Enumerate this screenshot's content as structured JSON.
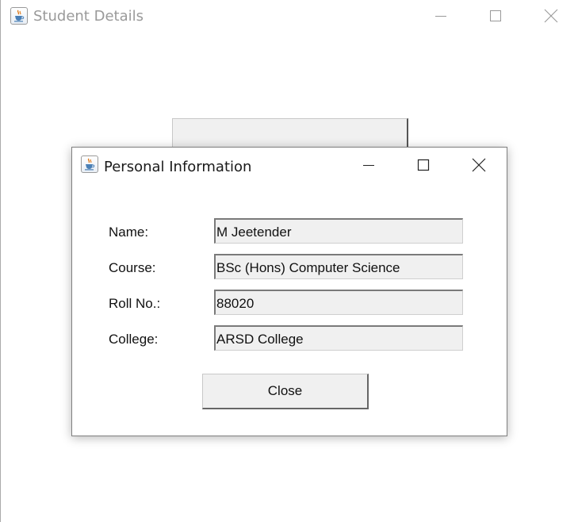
{
  "main_window": {
    "title": "Student Details",
    "icon": "java-cup-icon",
    "controls": [
      "minimize-icon",
      "maximize-icon",
      "close-icon"
    ]
  },
  "dialog": {
    "title": "Personal Information",
    "icon": "java-cup-icon",
    "controls": [
      "minimize-icon",
      "maximize-icon",
      "close-icon"
    ],
    "fields": [
      {
        "label": "Name:",
        "value": "M Jeetender"
      },
      {
        "label": "Course:",
        "value": "BSc (Hons) Computer Science"
      },
      {
        "label": "Roll No.:",
        "value": "88020"
      },
      {
        "label": "College:",
        "value": "ARSD College"
      }
    ],
    "close_button_label": "Close"
  },
  "colors": {
    "inactive_title_text": "#9a9a9a",
    "active_title_text": "#1a1a1a",
    "field_background": "#f0f0f0",
    "button_background": "#f0f0f0",
    "window_background": "#ffffff"
  }
}
